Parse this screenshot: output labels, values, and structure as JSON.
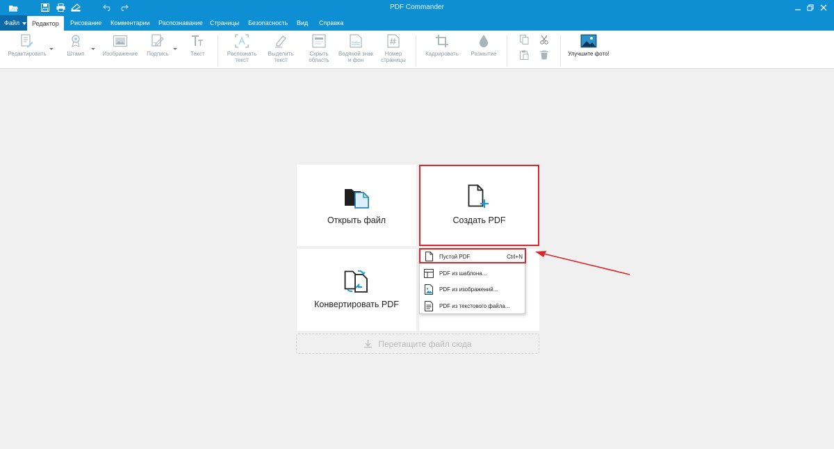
{
  "window": {
    "title": "PDF Commander"
  },
  "quick_access": [
    "open-folder-icon",
    "save-icon",
    "print-icon",
    "scan-icon",
    "undo-icon",
    "redo-icon"
  ],
  "menu_tabs": {
    "file": "Файл",
    "items": [
      "Редактор",
      "Рисование",
      "Комментарии",
      "Распознавание",
      "Страницы",
      "Безопасность",
      "Вид",
      "Справка"
    ],
    "active": "Редактор"
  },
  "ribbon": {
    "edit": "Редактировать",
    "stamp": "Штамп",
    "image": "Изображение",
    "signature": "Подпись",
    "text": "Текст",
    "recognize_text": [
      "Распознать",
      "текст"
    ],
    "select_text": [
      "Выделить",
      "текст"
    ],
    "hide_area": [
      "Скрыть",
      "область"
    ],
    "watermark": [
      "Водяной знак",
      "и фон"
    ],
    "page_number": [
      "Номер",
      "страницы"
    ],
    "crop": "Кадрировать",
    "blur": "Размытие",
    "improve_photo": "Улучшите фото!"
  },
  "start": {
    "open_file": "Открыть файл",
    "create_pdf": "Создать PDF",
    "convert_pdf": "Конвертировать PDF",
    "drop_hint": "Перетащите файл сюда"
  },
  "create_menu": [
    {
      "label": "Пустой PDF",
      "shortcut": "Ctrl+N",
      "icon": "blank-page-icon"
    },
    {
      "label": "PDF из шаблона...",
      "shortcut": "",
      "icon": "template-icon"
    },
    {
      "label": "PDF из изображений...",
      "shortcut": "",
      "icon": "image-file-icon"
    },
    {
      "label": "PDF из текстового файла...",
      "shortcut": "",
      "icon": "text-file-icon"
    }
  ],
  "colors": {
    "accent": "#0e8fd3",
    "highlight": "#d9262c"
  }
}
